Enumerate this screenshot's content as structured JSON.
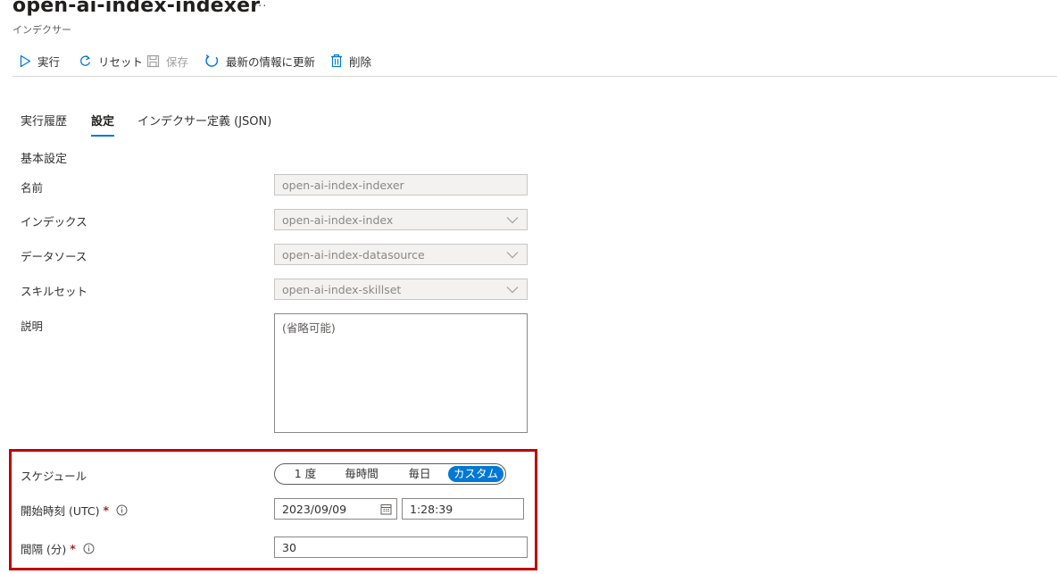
{
  "header": {
    "title": "open-ai-index-indexer",
    "more": "···",
    "subtitle": "インデクサー"
  },
  "toolbar": {
    "run": "実行",
    "reset": "リセット",
    "save": "保存",
    "refresh": "最新の情報に更新",
    "delete": "削除"
  },
  "tabs": {
    "history": "実行履歴",
    "settings": "設定",
    "definition": "インデクサー定義 (JSON)"
  },
  "form": {
    "section_title": "基本設定",
    "name": {
      "label": "名前",
      "value": "open-ai-index-indexer"
    },
    "index": {
      "label": "インデックス",
      "value": "open-ai-index-index"
    },
    "datasource": {
      "label": "データソース",
      "value": "open-ai-index-datasource"
    },
    "skillset": {
      "label": "スキルセット",
      "value": "open-ai-index-skillset"
    },
    "description": {
      "label": "説明",
      "placeholder": "(省略可能)"
    }
  },
  "schedule": {
    "label": "スケジュール",
    "options": [
      "1 度",
      "毎時間",
      "毎日",
      "カスタム"
    ],
    "selected": "カスタム",
    "start_label": "開始時刻 (UTC)",
    "start_date": "2023/09/09",
    "start_time": "1:28:39",
    "interval_label": "間隔 (分)",
    "interval_value": "30",
    "required_mark": "*"
  },
  "colors": {
    "accent": "#0078d4",
    "highlight": "#c00000",
    "required": "#a4262c"
  }
}
